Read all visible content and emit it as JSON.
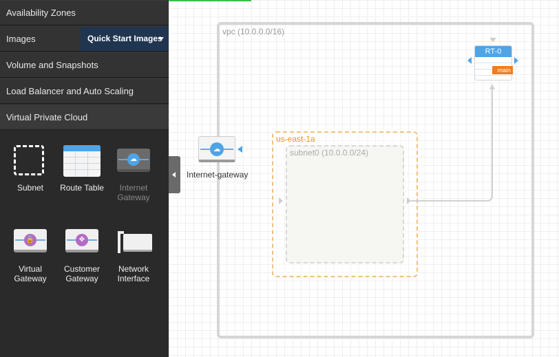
{
  "sidebar": {
    "sections": [
      {
        "label": "Availability Zones"
      },
      {
        "label": "Images"
      },
      {
        "label": "Volume and Snapshots"
      },
      {
        "label": "Load Balancer and Auto Scaling"
      },
      {
        "label": "Virtual Private Cloud"
      }
    ],
    "images_dropdown": "Quick Start Images",
    "palette": [
      {
        "label": "Subnet",
        "icon": "subnet-icon"
      },
      {
        "label": "Route Table",
        "icon": "route-table-icon"
      },
      {
        "label": "Internet Gateway",
        "icon": "internet-gateway-icon"
      },
      {
        "label": "Virtual Gateway",
        "icon": "virtual-gateway-icon"
      },
      {
        "label": "Customer Gateway",
        "icon": "customer-gateway-icon"
      },
      {
        "label": "Network Interface",
        "icon": "network-interface-icon"
      }
    ]
  },
  "canvas": {
    "vpc_label": "vpc (10.0.0.0/16)",
    "az_label": "us-east-1a",
    "subnet_label": "subnet0 (10.0.0.0/24)",
    "igw_label": "Internet-gateway",
    "route_table": {
      "title": "RT-0",
      "badge": "main"
    }
  },
  "colors": {
    "accent": "#4fa4e6",
    "az_border": "#f2c07c",
    "badge": "#f07c1b",
    "progress": "#3bbf4a"
  }
}
